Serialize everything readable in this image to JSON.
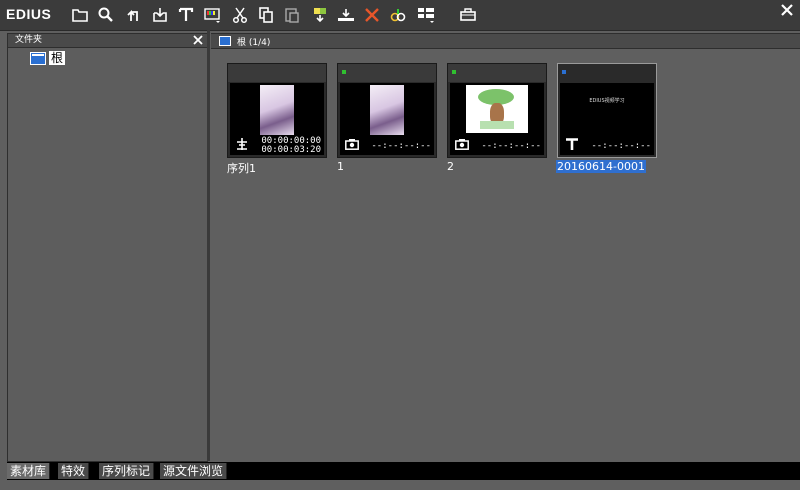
{
  "app": {
    "logo": "EDIUS"
  },
  "toolbar": {
    "buttons": [
      {
        "name": "new-folder-icon"
      },
      {
        "name": "search-icon"
      },
      {
        "name": "up-folder-icon"
      },
      {
        "name": "import-icon"
      },
      {
        "name": "title-icon"
      },
      {
        "name": "color-bar-icon"
      },
      {
        "name": "cut-icon"
      },
      {
        "name": "copy-icon"
      },
      {
        "name": "paste-icon"
      },
      {
        "name": "add-to-player-icon"
      },
      {
        "name": "add-to-timeline-icon"
      },
      {
        "name": "delete-icon"
      },
      {
        "name": "properties-icon"
      },
      {
        "name": "view-icon"
      },
      {
        "name": "more-icon"
      }
    ]
  },
  "folder_panel": {
    "title": "文件夹",
    "root_label": "根"
  },
  "bin": {
    "path_label": "根 (1/4)"
  },
  "clips": [
    {
      "label": "序列1",
      "tc_in": "00:00:00:00",
      "tc_out": "00:00:03:20",
      "kind": "sequence",
      "dot_color": "",
      "selected": false
    },
    {
      "label": "1",
      "tc_in": "",
      "tc_out": "--:--:--:--",
      "kind": "still",
      "dot_color": "#30c030",
      "selected": false
    },
    {
      "label": "2",
      "tc_in": "",
      "tc_out": "--:--:--:--",
      "kind": "still",
      "dot_color": "#30c030",
      "selected": false
    },
    {
      "label": "20160614-0001",
      "tc_in": "",
      "tc_out": "--:--:--:--",
      "kind": "title",
      "dot_color": "#2a6fd1",
      "selected": true,
      "thumb_text": "EDIUS视频学习"
    }
  ],
  "tabs": [
    "素材库",
    "特效",
    "序列标记",
    "源文件浏览"
  ]
}
